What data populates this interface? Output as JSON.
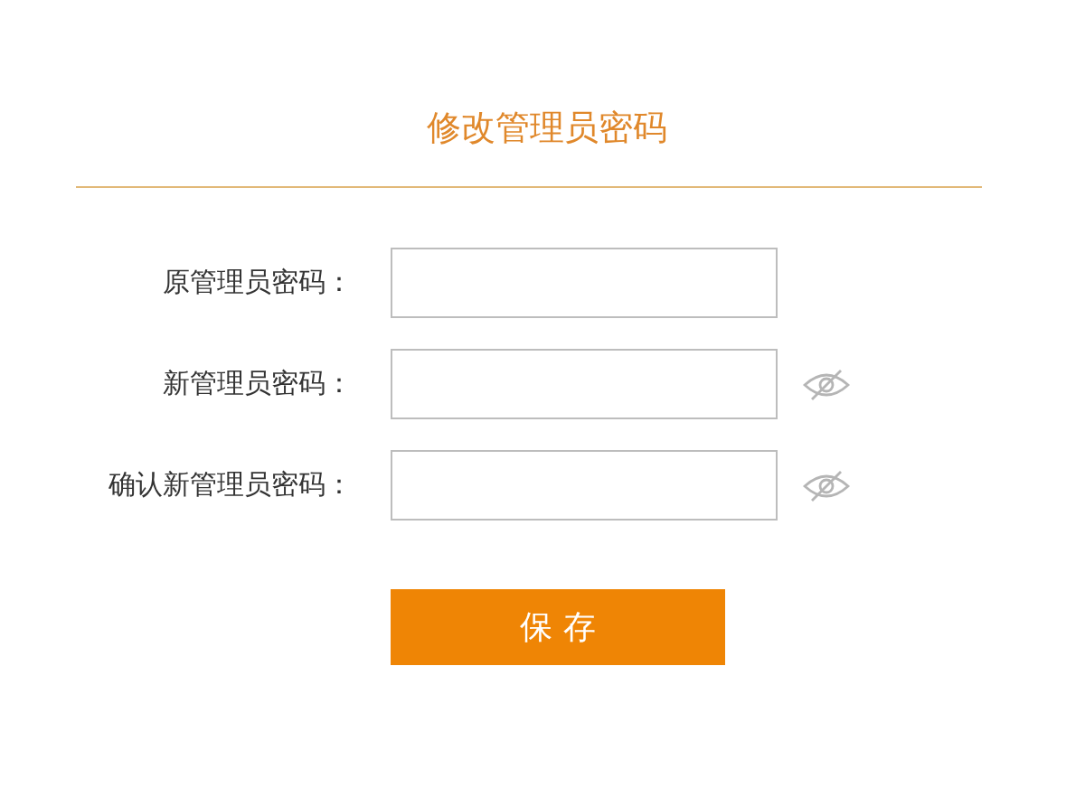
{
  "title": "修改管理员密码",
  "fields": [
    {
      "label": "原管理员密码：",
      "has_eye_toggle": false
    },
    {
      "label": "新管理员密码：",
      "has_eye_toggle": true
    },
    {
      "label": "确认新管理员密码：",
      "has_eye_toggle": true
    }
  ],
  "save_button": "保 存"
}
